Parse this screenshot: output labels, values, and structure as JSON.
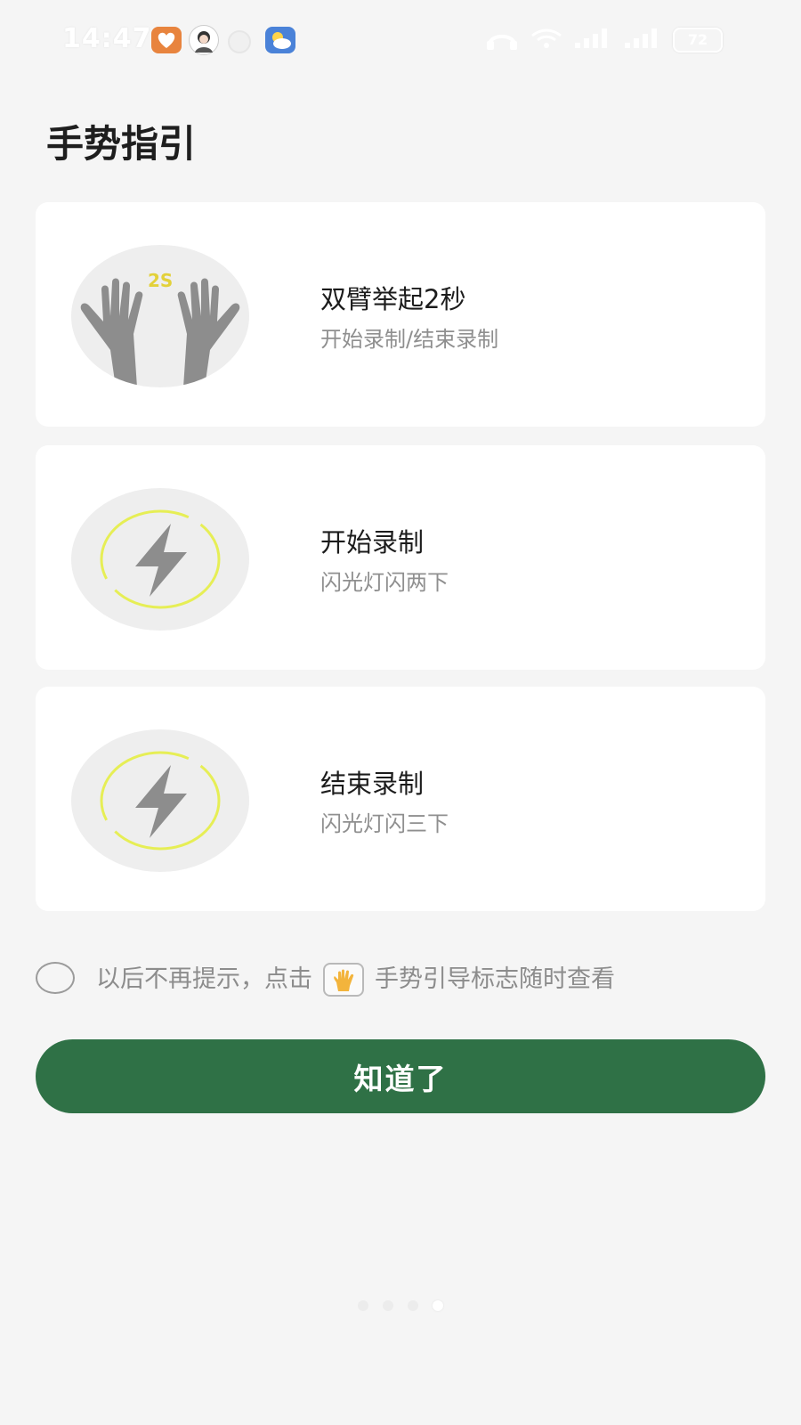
{
  "status_bar": {
    "time": "14:47",
    "battery": "72",
    "icons": [
      "heart-app-icon",
      "avatar-icon",
      "notification-dot-icon",
      "weather-icon",
      "headphones-icon",
      "wifi-icon",
      "signal-icon",
      "signal-icon",
      "battery-icon"
    ]
  },
  "page": {
    "title": "手势指引"
  },
  "cards": [
    {
      "title": "双臂举起2秒",
      "subtitle": "开始录制/结束录制",
      "badge": "2S",
      "icon": "raised-hands-icon"
    },
    {
      "title": "开始录制",
      "subtitle": "闪光灯闪两下",
      "icon": "flash-icon"
    },
    {
      "title": "结束录制",
      "subtitle": "闪光灯闪三下",
      "icon": "flash-icon"
    }
  ],
  "hint": {
    "text_before": "以后不再提示，点击",
    "text_after": "手势引导标志随时查看",
    "checked": false,
    "icon": "hand-wave-icon"
  },
  "actions": {
    "ok_label": "知道了"
  },
  "pager": {
    "total": 4,
    "current": 4
  },
  "colors": {
    "accent": "#2f7146",
    "flash_ring": "#e6ee55",
    "badge_text": "#e3d13a",
    "illustration_gray": "#8d8d8d"
  }
}
